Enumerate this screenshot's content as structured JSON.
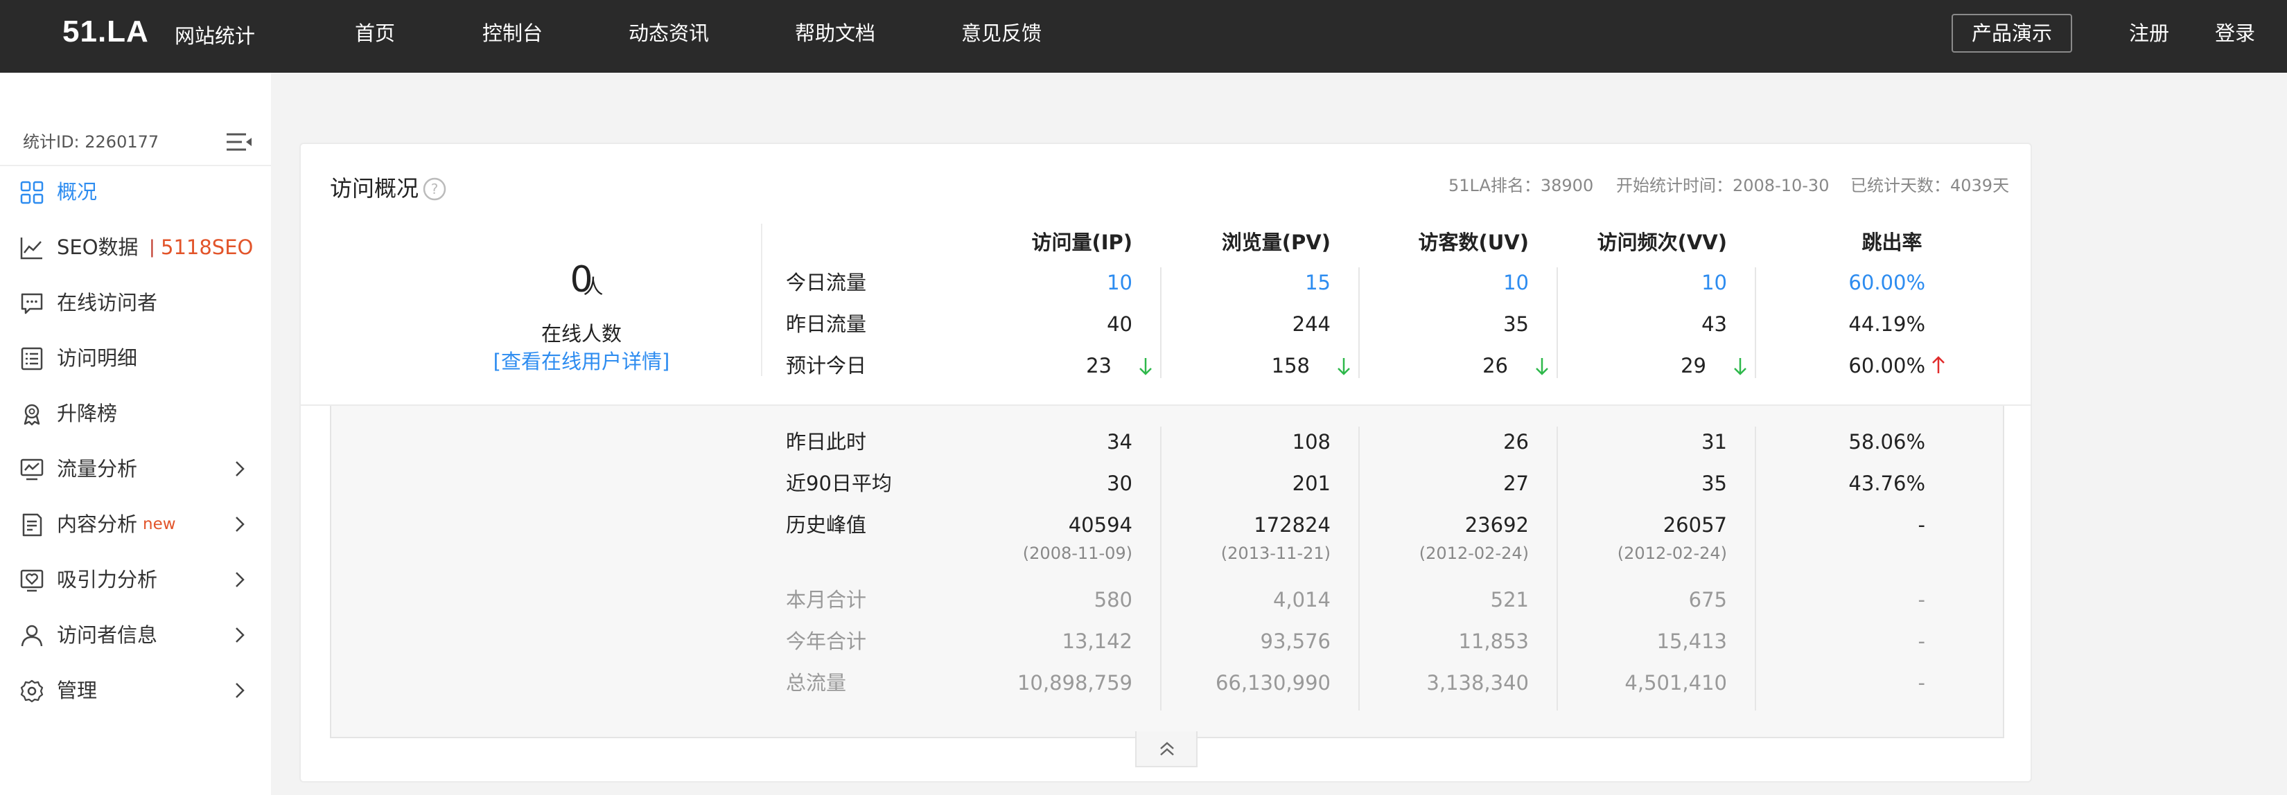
{
  "header": {
    "logo": "51.LA",
    "logo_sub": "网站统计",
    "nav": [
      "首页",
      "控制台",
      "动态资讯",
      "帮助文档",
      "意见反馈"
    ],
    "demo_button": "产品演示",
    "register": "注册",
    "login": "登录"
  },
  "sidebar": {
    "stat_id": "统计ID: 2260177",
    "items": [
      {
        "label": "概况",
        "icon": "grid-icon",
        "active": true
      },
      {
        "label": "SEO数据",
        "icon": "line-chart-icon",
        "tag": "5118SEO",
        "tag_sep": "|"
      },
      {
        "label": "在线访问者",
        "icon": "chat-icon"
      },
      {
        "label": "访问明细",
        "icon": "list-icon"
      },
      {
        "label": "升降榜",
        "icon": "badge-icon"
      },
      {
        "label": "流量分析",
        "icon": "monitor-chart-icon",
        "expandable": true
      },
      {
        "label": "内容分析",
        "icon": "document-icon",
        "tag": "new",
        "expandable": true
      },
      {
        "label": "吸引力分析",
        "icon": "heart-screen-icon",
        "expandable": true
      },
      {
        "label": "访问者信息",
        "icon": "user-icon",
        "expandable": true
      },
      {
        "label": "管理",
        "icon": "gear-icon",
        "expandable": true
      }
    ]
  },
  "overview": {
    "title": "访问概况",
    "rank": "51LA排名：38900",
    "start_date": "开始统计时间：2008-10-30",
    "days": "已统计天数：4039天",
    "online_count": "0",
    "online_unit": "人",
    "online_label": "在线人数",
    "online_link": "[查看在线用户详情]",
    "columns": [
      "访问量(IP)",
      "浏览量(PV)",
      "访客数(UV)",
      "访问频次(VV)",
      "跳出率"
    ],
    "rows_top": [
      {
        "label": "今日流量",
        "values": [
          "10",
          "15",
          "10",
          "10",
          "60.00%"
        ]
      },
      {
        "label": "昨日流量",
        "values": [
          "40",
          "244",
          "35",
          "43",
          "44.19%"
        ]
      },
      {
        "label": "预计今日",
        "values": [
          "23",
          "158",
          "26",
          "29",
          "60.00%"
        ],
        "trend": [
          "down",
          "down",
          "down",
          "down",
          "up"
        ]
      }
    ],
    "rows_mid": [
      {
        "label": "昨日此时",
        "values": [
          "34",
          "108",
          "26",
          "31",
          "58.06%"
        ]
      },
      {
        "label": "近90日平均",
        "values": [
          "30",
          "201",
          "27",
          "35",
          "43.76%"
        ]
      },
      {
        "label": "历史峰值",
        "values": [
          "40594",
          "172824",
          "23692",
          "26057",
          "-"
        ],
        "dates": [
          "(2008-11-09)",
          "(2013-11-21)",
          "(2012-02-24)",
          "(2012-02-24)"
        ]
      }
    ],
    "rows_bottom": [
      {
        "label": "本月合计",
        "values": [
          "580",
          "4,014",
          "521",
          "675",
          "-"
        ]
      },
      {
        "label": "今年合计",
        "values": [
          "13,142",
          "93,576",
          "11,853",
          "15,413",
          "-"
        ]
      },
      {
        "label": "总流量",
        "values": [
          "10,898,759",
          "66,130,990",
          "3,138,340",
          "4,501,410",
          "-"
        ]
      }
    ]
  },
  "colors": {
    "accent": "#2d8cf0",
    "down_arrow": "#2eb84b",
    "up_arrow": "#e02b2b",
    "tag": "#e2542a",
    "topbar": "#2a2a2a"
  }
}
